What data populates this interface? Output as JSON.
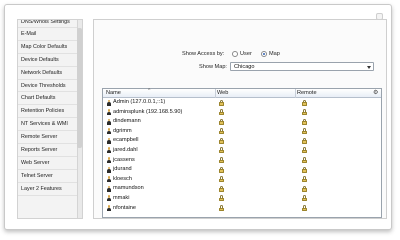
{
  "window": {
    "close_label": ""
  },
  "sidebar": {
    "items": [
      {
        "label": "DNS/Whois Settings",
        "cut": true
      },
      {
        "label": "E-Mail"
      },
      {
        "label": "Map Color Defaults"
      },
      {
        "label": "Device Defaults"
      },
      {
        "label": "Network Defaults"
      },
      {
        "label": "Device Thresholds"
      },
      {
        "label": "Chart Defaults"
      },
      {
        "label": "Retention Policies"
      },
      {
        "label": "NT Services & WMI"
      },
      {
        "label": "Remote Server"
      },
      {
        "label": "Reports Server"
      },
      {
        "label": "Web Server"
      },
      {
        "label": "Telnet Server"
      },
      {
        "label": "Layer 2 Features"
      }
    ]
  },
  "access": {
    "label": "Show Access by:",
    "options": [
      {
        "label": "User",
        "selected": false
      },
      {
        "label": "Map",
        "selected": true
      }
    ]
  },
  "map_select": {
    "label": "Show Map:",
    "value": "Chicago"
  },
  "table": {
    "columns": [
      "Name",
      "Web",
      "Remote"
    ],
    "rows": [
      {
        "name": "Admin (127.0.0.1,::1)"
      },
      {
        "name": "adminsplunk (192.168.5.90)"
      },
      {
        "name": "dindemann"
      },
      {
        "name": "dgrimm"
      },
      {
        "name": "ecampbell"
      },
      {
        "name": "jared.dahl"
      },
      {
        "name": "jcassens"
      },
      {
        "name": "jdurand"
      },
      {
        "name": "kloesch"
      },
      {
        "name": "mamundson"
      },
      {
        "name": "mmaki"
      },
      {
        "name": "nfontaine"
      }
    ],
    "row_icon": "user-icon",
    "cell_icon": "lock-icon",
    "settings_icon": "gear-icon"
  }
}
